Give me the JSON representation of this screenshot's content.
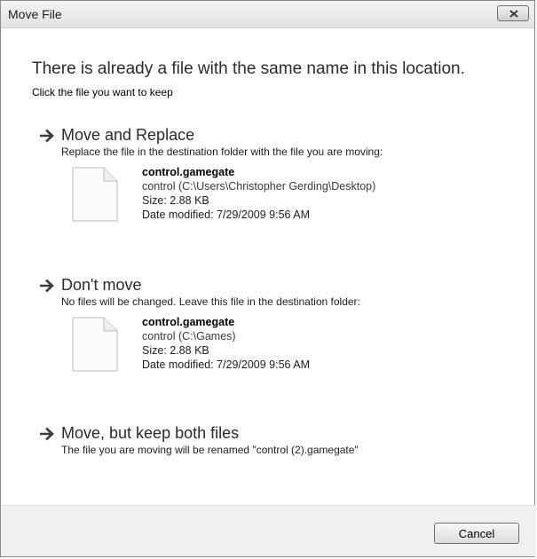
{
  "window": {
    "title": "Move File"
  },
  "heading": "There is already a file with the same name in this location.",
  "subheading": "Click the file you want to keep",
  "options": [
    {
      "title": "Move and Replace",
      "description": "Replace the file in the destination folder with the file you are moving:",
      "file": {
        "name": "control.gamegate",
        "path": "control (C:\\Users\\Christopher Gerding\\Desktop)",
        "size": "Size: 2.88 KB",
        "modified": "Date modified: 7/29/2009 9:56 AM"
      }
    },
    {
      "title": "Don't move",
      "description": "No files will be changed. Leave this file in the destination folder:",
      "file": {
        "name": "control.gamegate",
        "path": "control (C:\\Games)",
        "size": "Size: 2.88 KB",
        "modified": "Date modified: 7/29/2009 9:56 AM"
      }
    },
    {
      "title": "Move, but keep both files",
      "description": "The file you are moving will be renamed \"control (2).gamegate\""
    }
  ],
  "footer": {
    "cancel_label": "Cancel"
  },
  "icons": {
    "close": "close-icon",
    "arrow": "arrow-right-icon",
    "file": "file-icon"
  }
}
